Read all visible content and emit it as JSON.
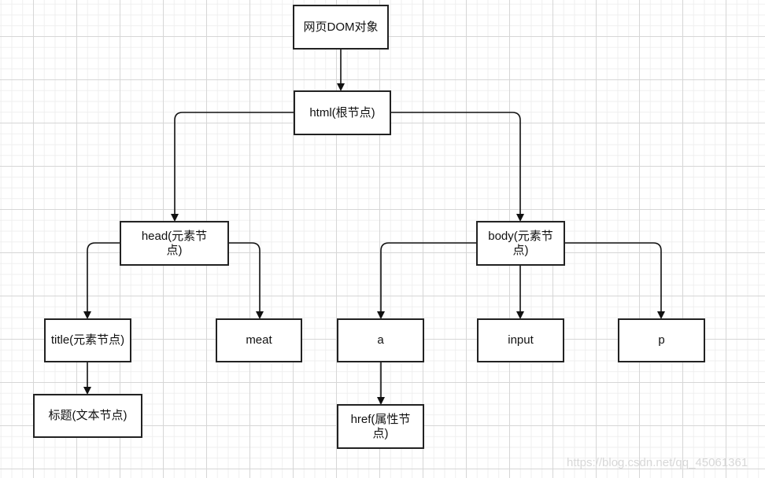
{
  "nodes": {
    "dom": "网页DOM对象",
    "html": "html(根节点)",
    "head": "head(元素节点)",
    "body": "body(元素节点)",
    "title": "title(元素节点)",
    "meat": "meat",
    "a": "a",
    "input": "input",
    "p": "p",
    "title_text": "标题(文本节点)",
    "href": "href(属性节点)"
  },
  "watermark": "https://blog.csdn.net/qq_45061361",
  "colors": {
    "stroke": "#222222",
    "grid_major": "#d6d6d6",
    "grid_minor": "#efefef"
  }
}
